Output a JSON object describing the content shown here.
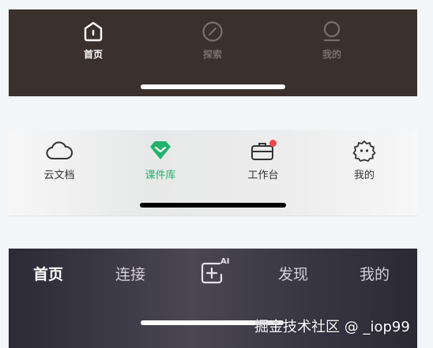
{
  "panel1": {
    "tabs": [
      {
        "label": "首页",
        "icon": "home-icon",
        "state": "active"
      },
      {
        "label": "探索",
        "icon": "compass-icon",
        "state": "inactive"
      },
      {
        "label": "我的",
        "icon": "profile-icon",
        "state": "inactive"
      }
    ],
    "colors": {
      "background": "#3a302c",
      "active": "#ffffff",
      "inactive": "#77706c"
    }
  },
  "panel2": {
    "tabs": [
      {
        "label": "云文档",
        "icon": "cloud-icon",
        "state": "inactive"
      },
      {
        "label": "课件库",
        "icon": "diamond-icon",
        "state": "active"
      },
      {
        "label": "工作台",
        "icon": "briefcase-icon",
        "state": "inactive",
        "badge": "dot"
      },
      {
        "label": "我的",
        "icon": "smiley-icon",
        "state": "inactive"
      }
    ],
    "colors": {
      "active": "#23b26b",
      "badge": "#f04848",
      "text": "#333333"
    }
  },
  "panel3": {
    "tabs": [
      {
        "label": "首页",
        "state": "active"
      },
      {
        "label": "连接",
        "state": "inactive"
      },
      {
        "label": "AI",
        "icon": "ai-plus-icon"
      },
      {
        "label": "发现",
        "state": "inactive"
      },
      {
        "label": "我的",
        "state": "inactive"
      }
    ],
    "colors": {
      "active": "#ffffff",
      "inactive": "#d2d0d8"
    }
  },
  "watermark": "掘金技术社区 @ _iop99"
}
